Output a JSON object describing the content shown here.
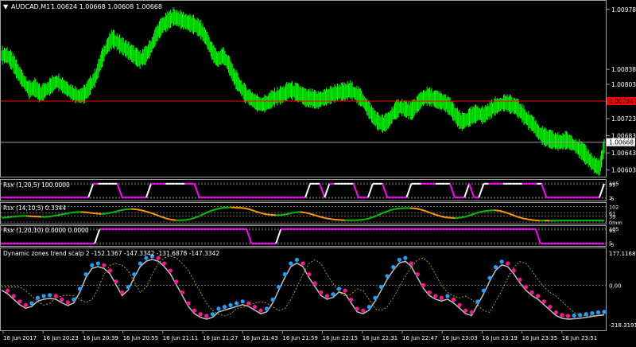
{
  "window": {
    "title": "AUDCAD,M1",
    "ohlc": "1.00624 1.00668 1.00608 1.00668"
  },
  "colors": {
    "background": "#000000",
    "candles": "#00ff00",
    "grid": "#2e2e2e",
    "frame": "#a0a0a0",
    "red_line": "#ff0000",
    "red_label_bg": "#ff0000",
    "rsx_fast": "#ffffff",
    "rsx_alt": "#ff00ff",
    "rsx_mid_up": "#00c000",
    "rsx_mid_down": "#ff9900",
    "dz_up": "#1ea0ff",
    "dz_down": "#ff1493",
    "dz_band": "#c8c800",
    "dz_envelope": "#bfbfbf",
    "text": "#ffffff"
  },
  "main_panel": {
    "price_labels": [
      "1.00978",
      "1.00838",
      "1.00803",
      "1.00723",
      "1.00683",
      "1.00643",
      "1.00603"
    ],
    "red_line_price": "1.00764",
    "current_price": "1.00668",
    "chart_data": {
      "type": "candlestick",
      "ylim": [
        1.00595,
        1.00985
      ],
      "close": [
        1.0087,
        1.00855,
        1.0083,
        1.0081,
        1.0079,
        1.00795,
        1.0078,
        1.0079,
        1.008,
        1.0081,
        1.008,
        1.0079,
        1.0078,
        1.00775,
        1.0078,
        1.008,
        1.0082,
        1.0086,
        1.0089,
        1.0091,
        1.009,
        1.0089,
        1.0088,
        1.0087,
        1.0086,
        1.0087,
        1.0089,
        1.0092,
        1.0094,
        1.0095,
        1.0096,
        1.00955,
        1.0095,
        1.00945,
        1.0094,
        1.0093,
        1.0091,
        1.0088,
        1.0086,
        1.0087,
        1.0085,
        1.0082,
        1.008,
        1.0078,
        1.0077,
        1.0076,
        1.00755,
        1.0076,
        1.0077,
        1.00775,
        1.0078,
        1.0079,
        1.00785,
        1.0078,
        1.0077,
        1.0077,
        1.00765,
        1.0077,
        1.00775,
        1.0078,
        1.00785,
        1.00785,
        1.0079,
        1.0078,
        1.0077,
        1.0075,
        1.0073,
        1.00715,
        1.0071,
        1.0072,
        1.0074,
        1.0075,
        1.00745,
        1.0074,
        1.00755,
        1.0077,
        1.00775,
        1.0077,
        1.00765,
        1.0076,
        1.0075,
        1.0073,
        1.00715,
        1.0072,
        1.0073,
        1.00735,
        1.0073,
        1.0074,
        1.0075,
        1.00755,
        1.0076,
        1.00755,
        1.0075,
        1.00735,
        1.0072,
        1.0071,
        1.0069,
        1.0068,
        1.00675,
        1.0067,
        1.00668,
        1.00672,
        1.00665,
        1.00655,
        1.00645,
        1.0063,
        1.00615,
        1.00608,
        1.00668
      ]
    }
  },
  "indicators": [
    {
      "label": "Rsx (1,20,5) 100.0000",
      "levels": [
        "105",
        "95",
        "1",
        "-5"
      ],
      "chart_data": {
        "type": "line",
        "series": [
          {
            "values": [
              0,
              0,
              0,
              0,
              0,
              0,
              0,
              0,
              0,
              0,
              0,
              0,
              0,
              0,
              0,
              0,
              0,
              0,
              0,
              100,
              100,
              100,
              100,
              100,
              100,
              0,
              0,
              0,
              0,
              0,
              0,
              100,
              100,
              100,
              100,
              100,
              100,
              100,
              100,
              100,
              100,
              0,
              0,
              0,
              0,
              0,
              0,
              0,
              0,
              0,
              0,
              0,
              0,
              0,
              0,
              0,
              0,
              0,
              0,
              0,
              0,
              0,
              0,
              0,
              100,
              100,
              100,
              0,
              100,
              100,
              100,
              100,
              100,
              100,
              0,
              0,
              0,
              100,
              100,
              100,
              0,
              0,
              0,
              0,
              0,
              100,
              100,
              100,
              100,
              100,
              100,
              100,
              100,
              100,
              0,
              0,
              0,
              100,
              0,
              0,
              100,
              100,
              100,
              100,
              100,
              100,
              100,
              100,
              100,
              100,
              100,
              100,
              100,
              0,
              0,
              0,
              0,
              0,
              0,
              0,
              0,
              0,
              0,
              0,
              0,
              100
            ]
          }
        ],
        "ylim": [
          -5,
          105
        ]
      }
    },
    {
      "label": "Rsx (14,10,5) 0.3344",
      "levels": [
        "102",
        "61",
        "39",
        "0mm"
      ],
      "chart_data": {
        "type": "line",
        "series": [
          {
            "values": [
              28,
              30,
              34,
              38,
              40,
              40,
              38,
              36,
              34,
              34,
              38,
              44,
              50,
              56,
              62,
              66,
              66,
              64,
              60,
              56,
              54,
              56,
              62,
              70,
              78,
              84,
              86,
              84,
              78,
              70,
              60,
              48,
              36,
              24,
              16,
              12,
              12,
              14,
              20,
              30,
              44,
              60,
              74,
              84,
              92,
              96,
              97,
              96,
              94,
              90,
              82,
              70,
              60,
              52,
              48,
              46,
              46,
              50,
              58,
              64,
              66,
              62,
              54,
              44,
              34,
              26,
              20,
              16,
              14,
              12,
              12,
              12,
              14,
              18,
              26,
              38,
              52,
              66,
              78,
              86,
              90,
              92,
              92,
              90,
              84,
              74,
              62,
              50,
              40,
              32,
              28,
              26,
              28,
              34,
              44,
              56,
              66,
              72,
              76,
              78,
              74,
              66,
              54,
              42,
              30,
              22,
              16,
              12,
              10,
              10,
              9,
              9,
              10,
              10,
              10,
              10,
              10,
              10,
              10,
              10,
              10,
              10
            ]
          }
        ],
        "ylim": [
          0,
          105
        ]
      }
    },
    {
      "label": "Rsx (1,20,10) 0.0000 0.0000",
      "levels": [
        "105",
        "95",
        "5",
        "-5"
      ],
      "chart_data": {
        "type": "line",
        "series": [
          {
            "values": [
              0,
              0,
              0,
              0,
              0,
              0,
              0,
              0,
              0,
              0,
              0,
              0,
              0,
              0,
              0,
              0,
              0,
              0,
              0,
              0,
              100,
              100,
              100,
              100,
              100,
              100,
              100,
              100,
              100,
              100,
              100,
              100,
              100,
              100,
              100,
              100,
              100,
              100,
              100,
              100,
              100,
              100,
              100,
              100,
              100,
              100,
              100,
              100,
              100,
              100,
              100,
              0,
              0,
              0,
              0,
              0,
              0,
              100,
              100,
              100,
              100,
              100,
              100,
              100,
              100,
              100,
              100,
              100,
              100,
              100,
              100,
              100,
              100,
              100,
              100,
              100,
              100,
              100,
              100,
              100,
              100,
              100,
              100,
              100,
              100,
              100,
              100,
              100,
              100,
              100,
              100,
              100,
              100,
              100,
              100,
              100,
              100,
              100,
              100,
              100,
              100,
              100,
              100,
              100,
              100,
              100,
              100,
              100,
              100,
              100,
              0,
              0,
              0,
              0,
              0,
              0,
              0,
              0,
              0,
              0,
              0,
              0,
              0,
              0
            ]
          }
        ],
        "ylim": [
          -5,
          105
        ]
      }
    },
    {
      "label": "Dynamic zones trend scalp 2 -152.1367 -147.3342 -131.6878 -147.3342",
      "levels": [
        "177.1168",
        "0.00",
        "-218.3191"
      ],
      "chart_data": {
        "type": "line",
        "ylim": [
          -218.3191,
          177.1168
        ],
        "series": [
          {
            "values": [
              -10,
              -30,
              -60,
              -90,
              -110,
              -100,
              -70,
              -60,
              -55,
              -60,
              -80,
              -95,
              -80,
              -20,
              60,
              110,
              120,
              110,
              80,
              20,
              -40,
              -10,
              60,
              120,
              150,
              160,
              150,
              120,
              80,
              20,
              -40,
              -100,
              -140,
              -160,
              -170,
              -160,
              -130,
              -120,
              -110,
              -100,
              -90,
              -100,
              -120,
              -140,
              -130,
              -80,
              -10,
              60,
              120,
              140,
              120,
              60,
              10,
              -40,
              -60,
              -50,
              -20,
              -30,
              -80,
              -130,
              -140,
              -120,
              -70,
              -10,
              50,
              100,
              140,
              150,
              120,
              60,
              0,
              -40,
              -60,
              -70,
              -60,
              -80,
              -110,
              -140,
              -150,
              -90,
              -30,
              40,
              100,
              130,
              120,
              80,
              30,
              -10,
              -40,
              -60,
              -90,
              -120,
              -150,
              -165,
              -170,
              -168,
              -165,
              -160,
              -155,
              -150,
              -147
            ]
          }
        ]
      }
    }
  ],
  "time_axis": {
    "labels": [
      "16 Jun 2017",
      "16 Jun 20:23",
      "16 Jun 20:39",
      "16 Jun 20:55",
      "16 Jun 21:11",
      "16 Jun 21:27",
      "16 Jun 21:43",
      "16 Jun 21:59",
      "16 Jun 22:15",
      "16 Jun 22:31",
      "16 Jun 22:47",
      "16 Jun 23:03",
      "16 Jun 23:19",
      "16 Jun 23:35",
      "16 Jun 23:51"
    ]
  }
}
